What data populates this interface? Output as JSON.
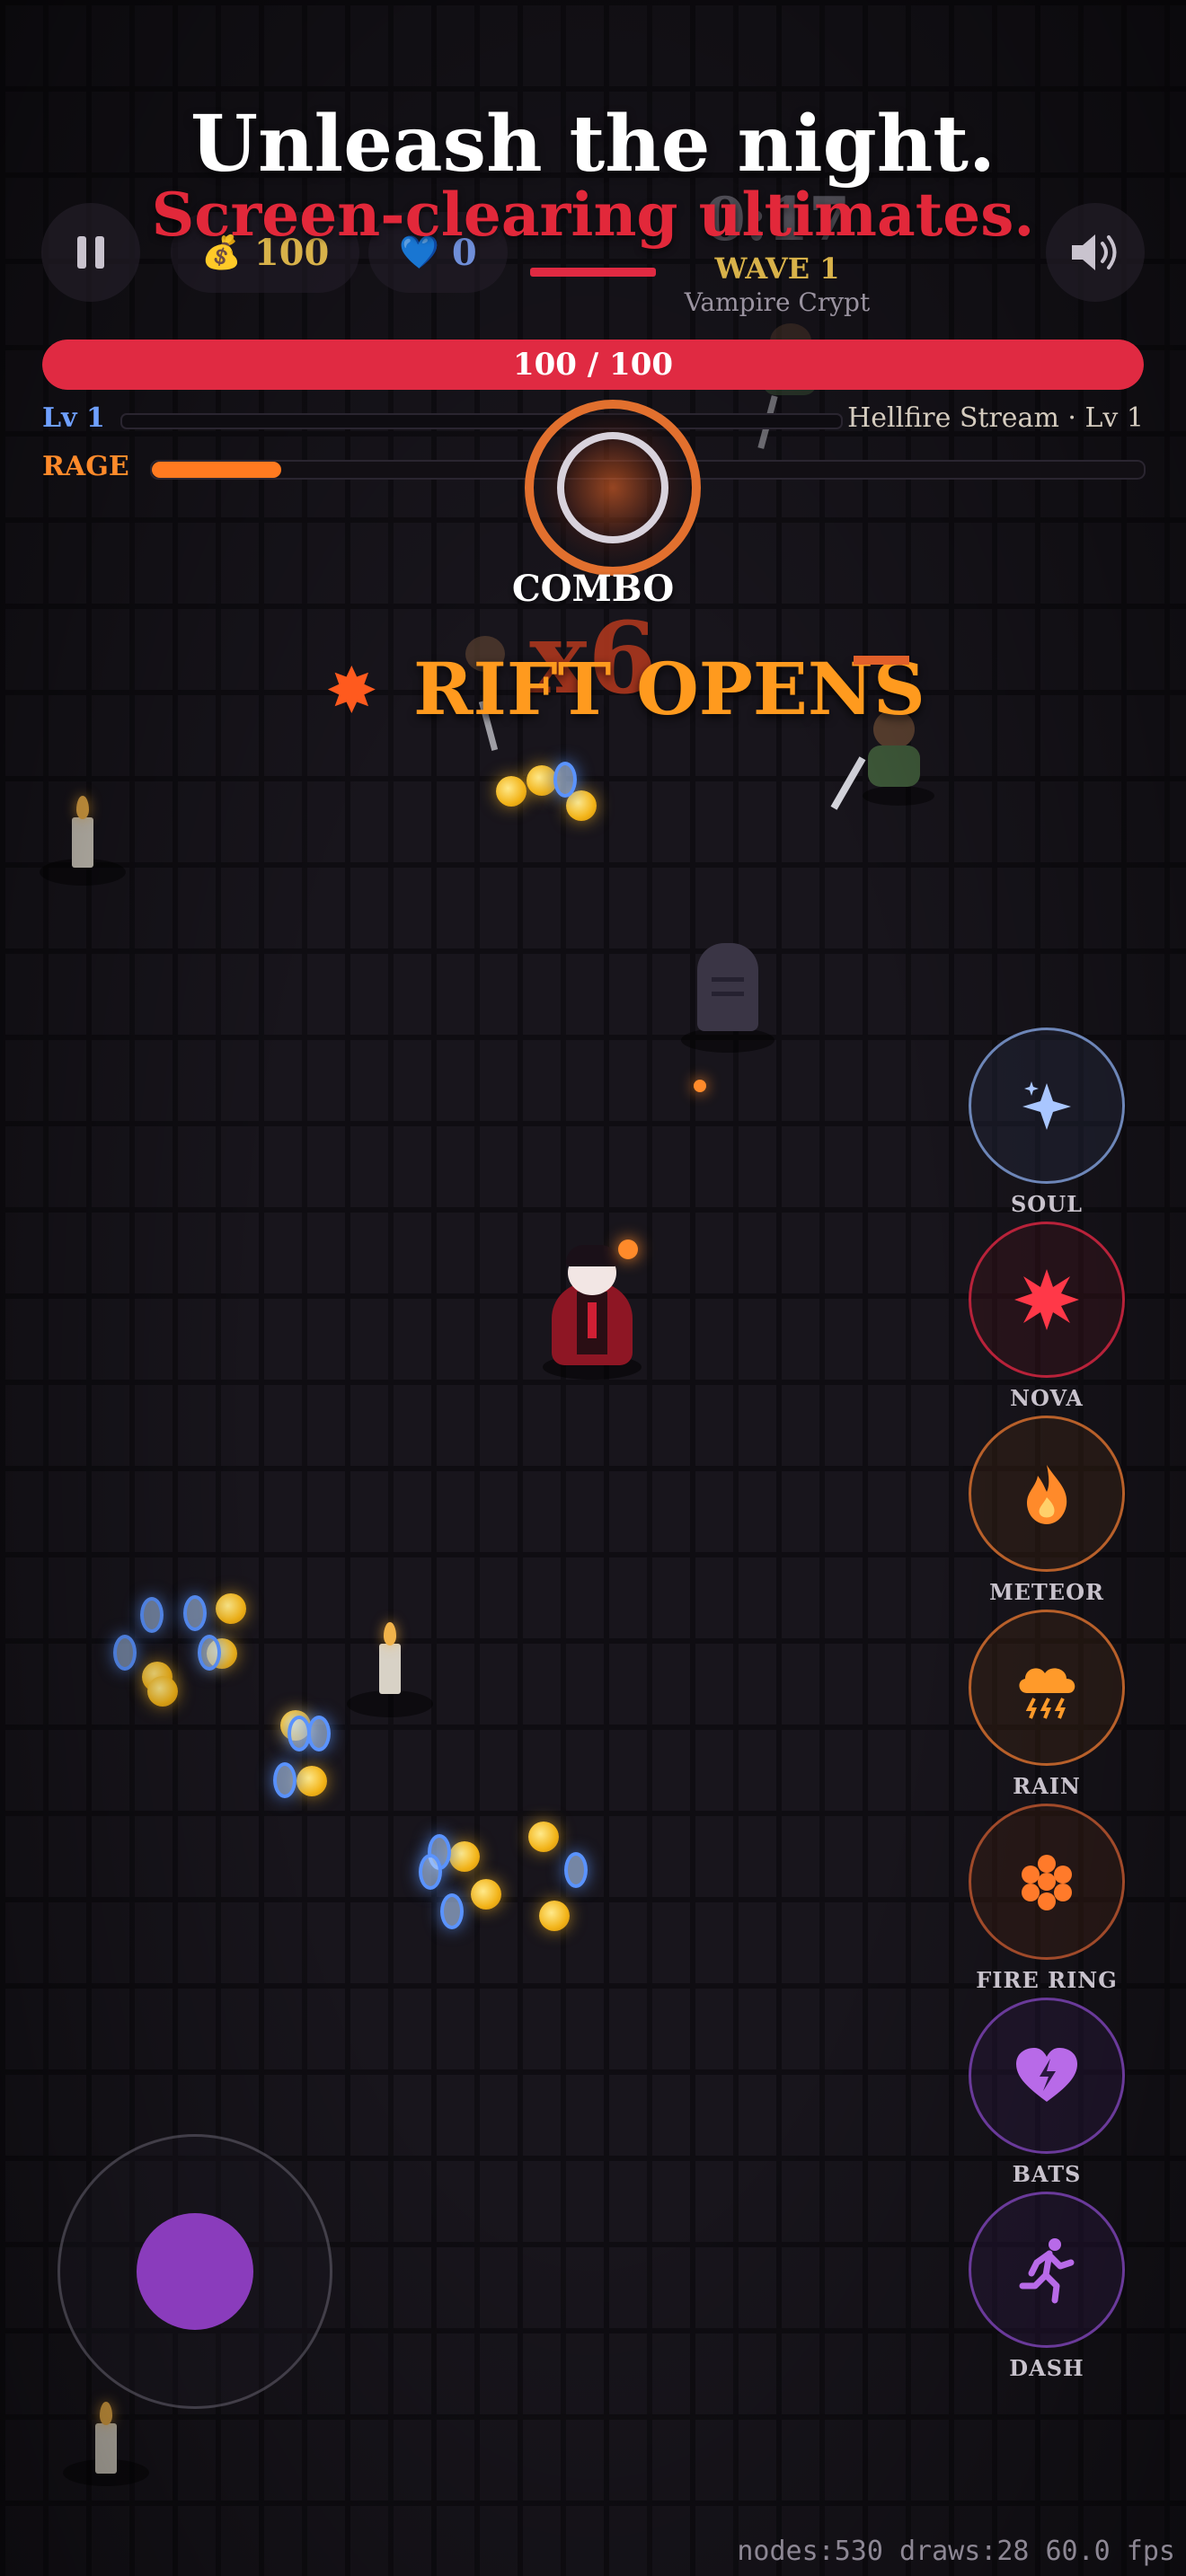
{
  "headline": {
    "line1": "Unleash the night.",
    "line2": "Screen-clearing ultimates."
  },
  "hud": {
    "gold": "100",
    "souls": "0",
    "timer": "0:17",
    "wave": "WAVE 1",
    "stage": "Vampire Crypt",
    "hp_text": "100 / 100",
    "hp_fraction": 1.0,
    "level": "Lv 1",
    "xp_fraction": 0.0,
    "weapon": "Hellfire Stream · Lv 1",
    "rage_label": "RAGE",
    "rage_fraction": 0.13
  },
  "combo": {
    "label": "COMBO",
    "multiplier": "x6",
    "event": "RIFT OPENS"
  },
  "skills": [
    {
      "label": "SOUL",
      "icon": "sparkle-icon",
      "color": "#6d86b8"
    },
    {
      "label": "NOVA",
      "icon": "burst-icon",
      "color": "#b8223a"
    },
    {
      "label": "METEOR",
      "icon": "flame-icon",
      "color": "#b8602a"
    },
    {
      "label": "RAIN",
      "icon": "storm-cloud-icon",
      "color": "#b8602a"
    },
    {
      "label": "FIRE RING",
      "icon": "fire-cluster-icon",
      "color": "#a04a2a"
    },
    {
      "label": "BATS",
      "icon": "heart-bolt-icon",
      "color": "#6a3a9a"
    },
    {
      "label": "DASH",
      "icon": "running-figure-icon",
      "color": "#6a3a9a"
    }
  ],
  "debug": {
    "perf": "nodes:530 draws:28  60.0 fps"
  },
  "colors": {
    "hp": "#e02a42",
    "xp": "#4f7be0",
    "rage": "#ff7a20",
    "gold": "#d8b24a",
    "joystick": "#8a3cbc"
  }
}
